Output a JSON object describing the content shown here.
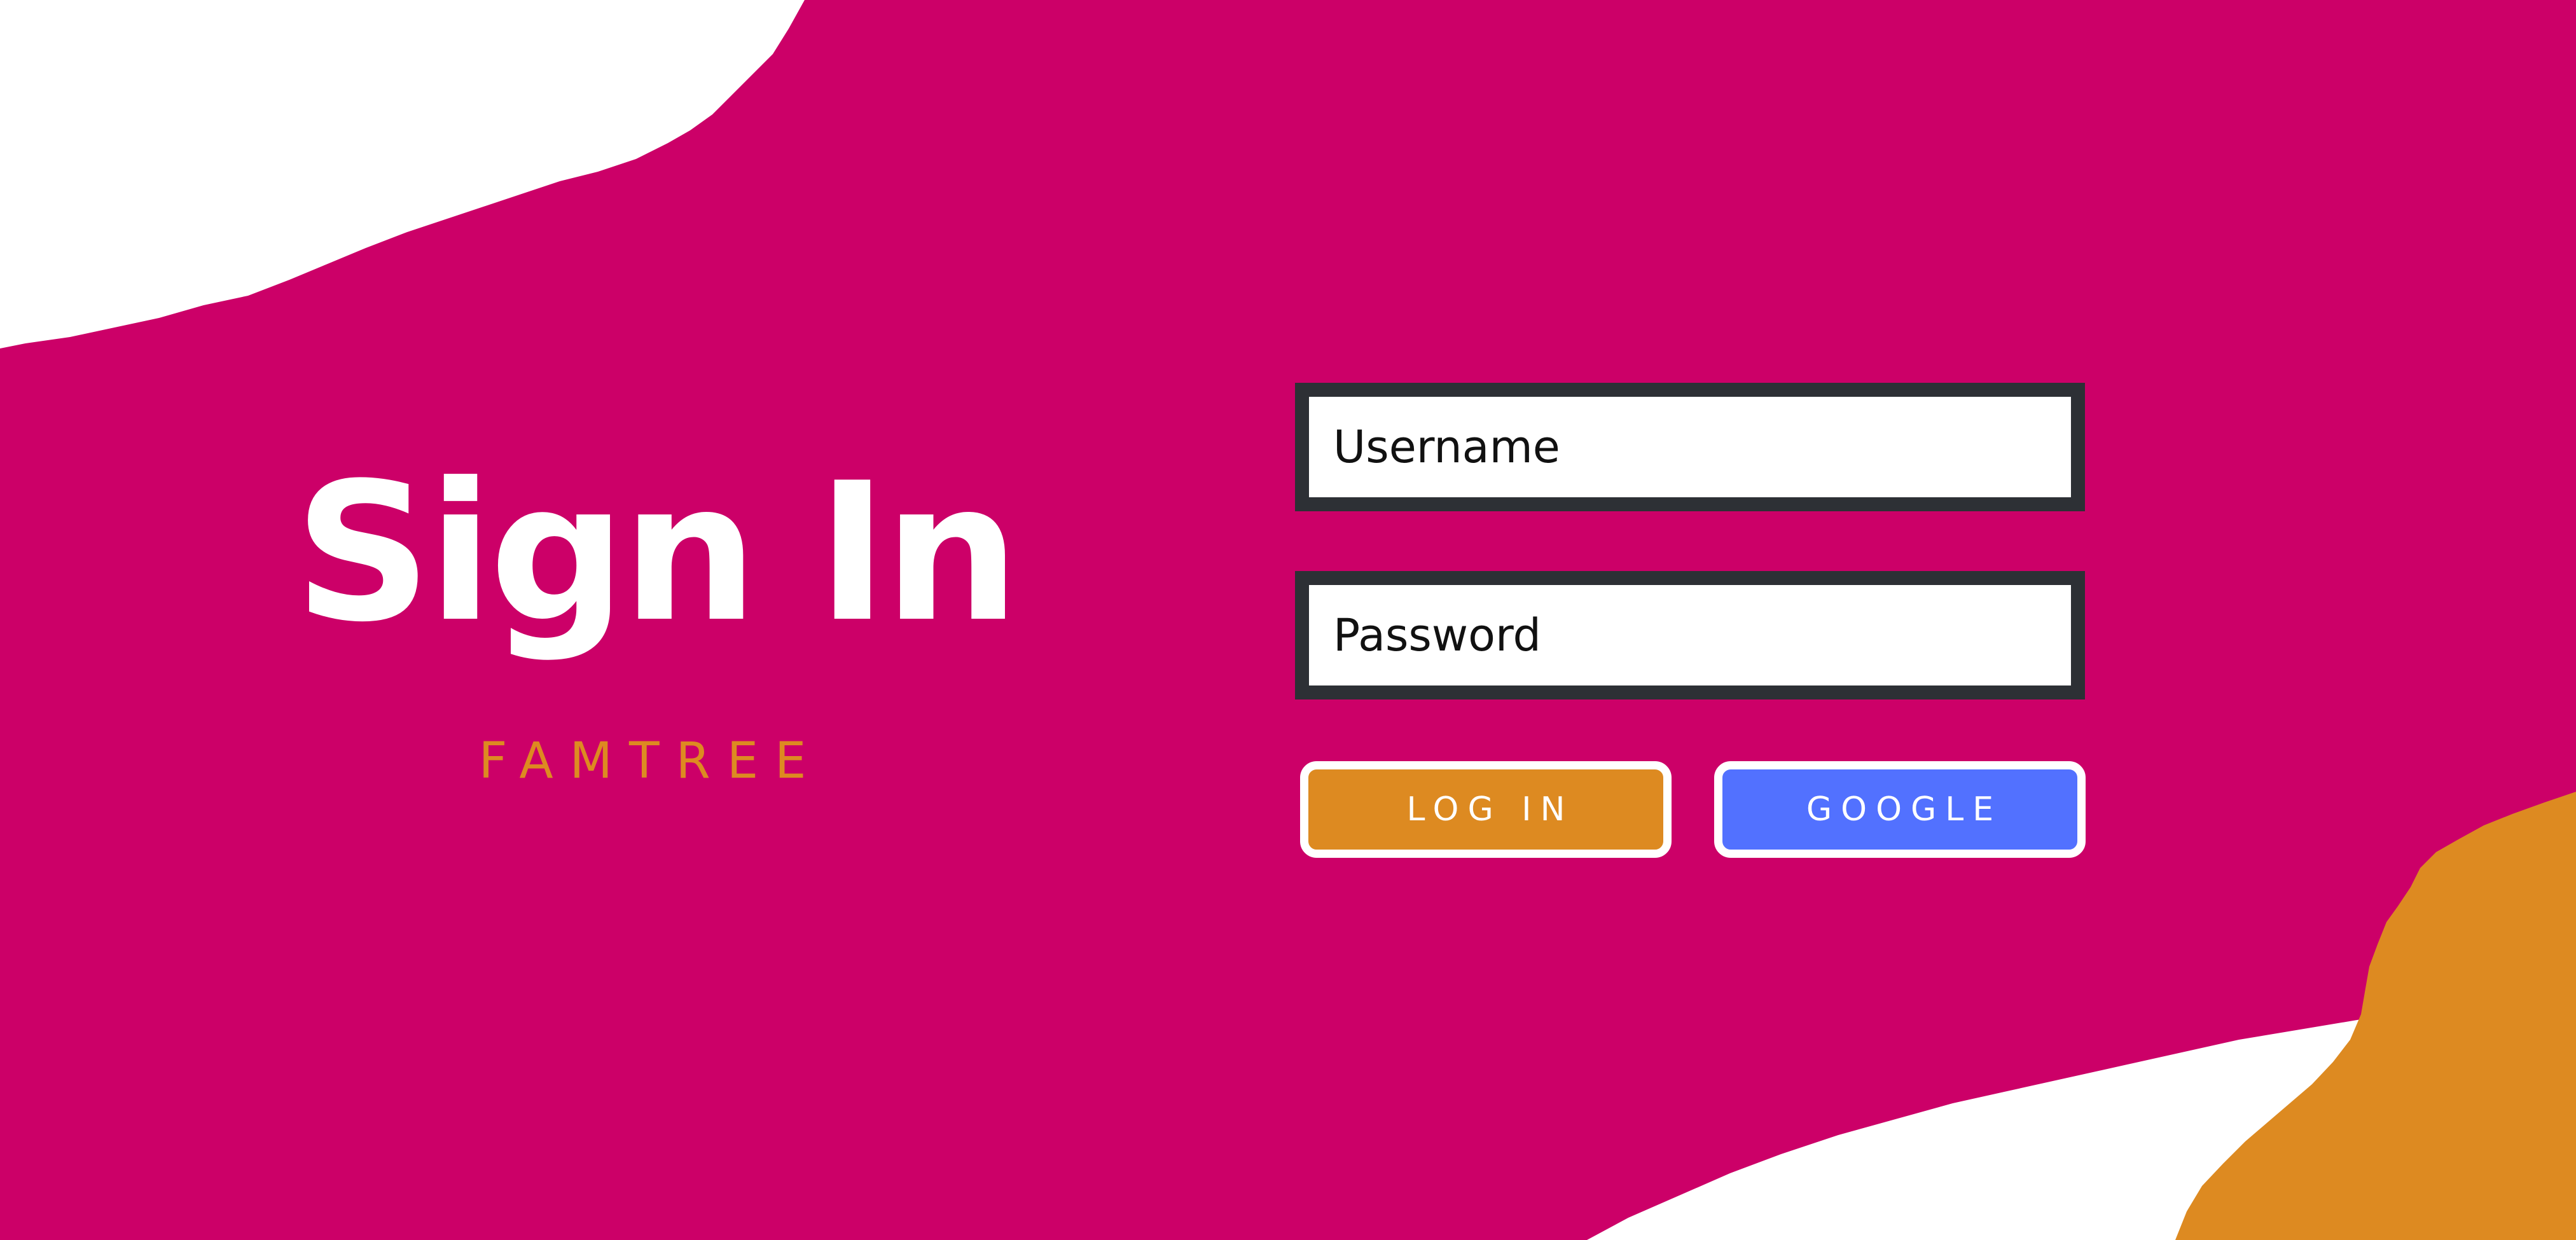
{
  "colors": {
    "background": "#cc0068",
    "paper": "#ffffff",
    "accent_orange": "#dd8a21",
    "google_blue": "#5271ff",
    "field_border": "#2d3035"
  },
  "heading": {
    "title": "Sign In",
    "brand": "FAMTREE"
  },
  "form": {
    "username_placeholder": "Username",
    "password_placeholder": "Password",
    "login_label": "LOG IN",
    "google_label": "GOOGLE"
  }
}
